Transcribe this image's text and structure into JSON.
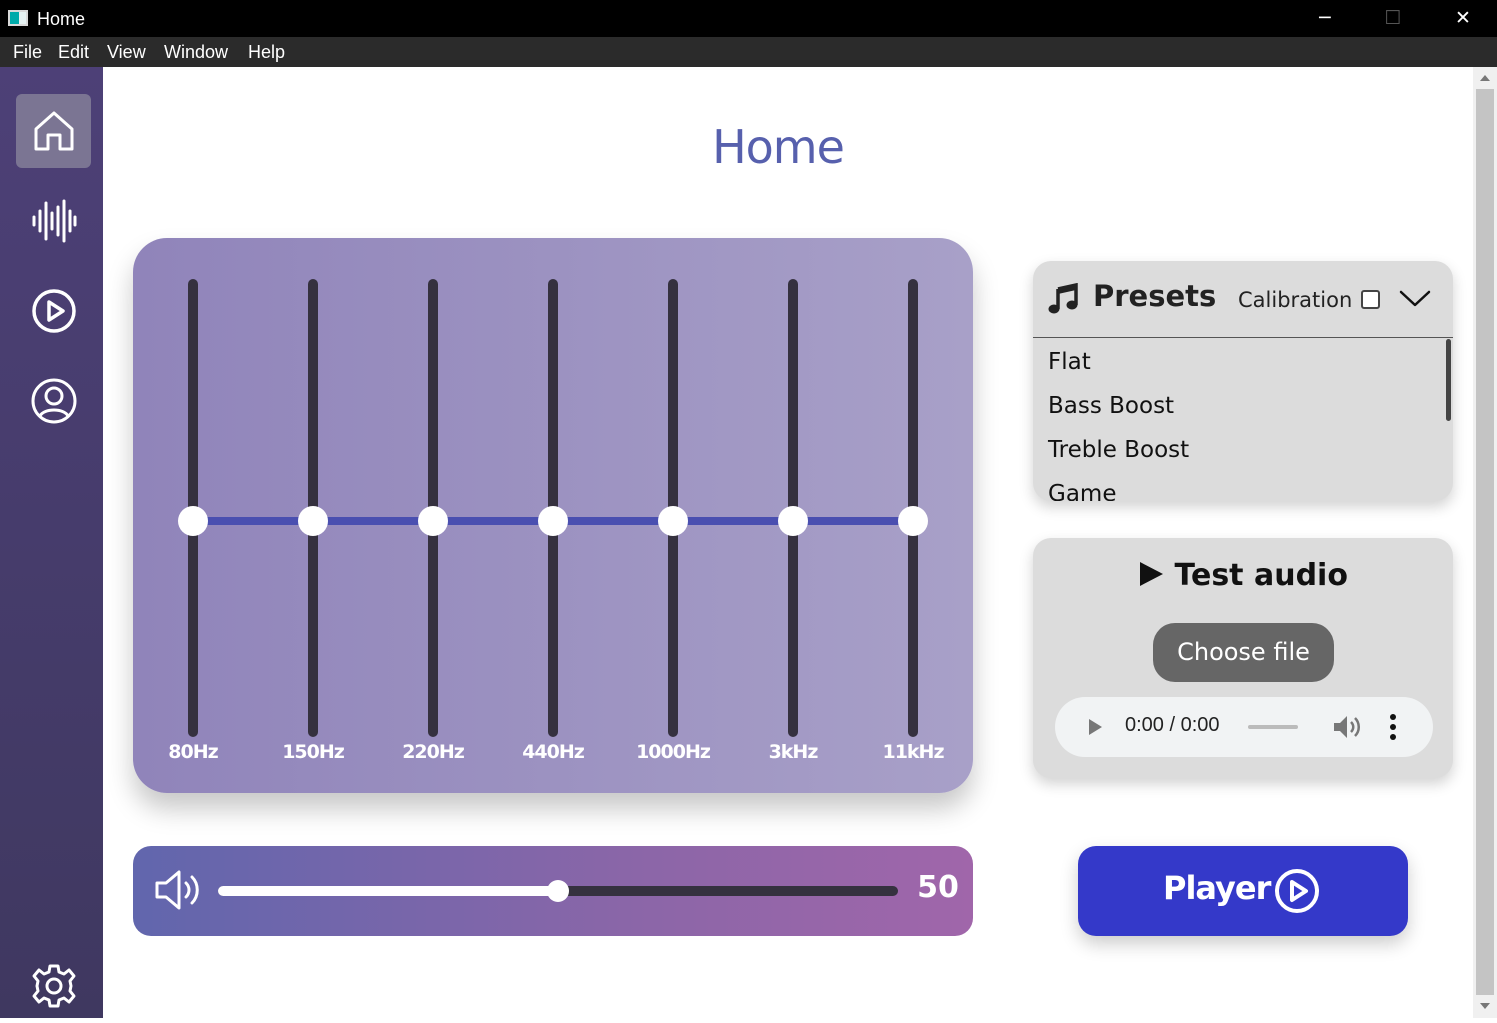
{
  "window": {
    "title": "Home",
    "minimize": "─",
    "maximize": "☐",
    "close": "✕"
  },
  "menubar": {
    "items": [
      "File",
      "Edit",
      "View",
      "Window",
      "Help"
    ]
  },
  "sidebar": {
    "items": [
      {
        "icon": "home-icon",
        "active": true
      },
      {
        "icon": "waveform-icon",
        "active": false
      },
      {
        "icon": "play-circle-icon",
        "active": false
      },
      {
        "icon": "user-circle-icon",
        "active": false
      }
    ],
    "settings_icon": "gear-icon",
    "accent": "#4d4077"
  },
  "page": {
    "title": "Home",
    "title_color": "#5760ad"
  },
  "equalizer": {
    "bands": [
      {
        "label": "80Hz",
        "level": 0.5
      },
      {
        "label": "150Hz",
        "level": 0.5
      },
      {
        "label": "220Hz",
        "level": 0.5
      },
      {
        "label": "440Hz",
        "level": 0.5
      },
      {
        "label": "1000Hz",
        "level": 0.5
      },
      {
        "label": "3kHz",
        "level": 0.5
      },
      {
        "label": "11kHz",
        "level": 0.5
      }
    ],
    "curve_color": "#4a4fb0"
  },
  "volume": {
    "value": "50",
    "level": 0.5,
    "icon": "speaker-icon"
  },
  "presets": {
    "title": "Presets",
    "calibration_label": "Calibration",
    "calibration_checked": false,
    "items": [
      "Flat",
      "Bass Boost",
      "Treble Boost",
      "Game"
    ]
  },
  "test_audio": {
    "title": "Test audio",
    "choose_file": "Choose file",
    "time": "0:00 / 0:00"
  },
  "player": {
    "label": "Player",
    "color": "#3439c9"
  }
}
